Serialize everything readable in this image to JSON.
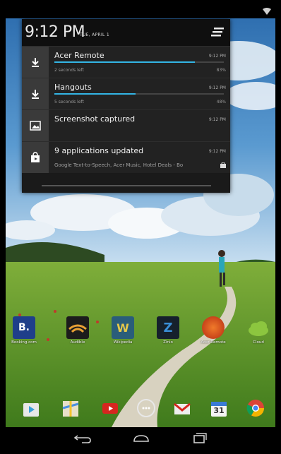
{
  "shade": {
    "time": "9:12 PM",
    "date": "TUE, APRIL 1",
    "notifications": [
      {
        "icon": "download-icon",
        "title": "Acer Remote",
        "time": "9:12 PM",
        "sub": "2 seconds left",
        "pct": "83%",
        "progress": 0.83
      },
      {
        "icon": "download-icon",
        "title": "Hangouts",
        "time": "9:12 PM",
        "sub": "5 seconds left",
        "pct": "48%",
        "progress": 0.48
      },
      {
        "icon": "image-icon",
        "title": "Screenshot captured",
        "time": "9:12 PM"
      },
      {
        "icon": "store-bag-icon",
        "title": "9 applications updated",
        "time": "9:12 PM",
        "desc": "Google Text-to-Speech, Acer Music, Hotel Deals - Bo"
      }
    ]
  },
  "apps": [
    {
      "label": "Booking.com",
      "icon_text": "B."
    },
    {
      "label": "Audible",
      "icon_text": ""
    },
    {
      "label": "Wikipedia",
      "icon_text": "W"
    },
    {
      "label": "Zinio",
      "icon_text": "Z"
    },
    {
      "label": "Acer Remote",
      "icon_text": ""
    },
    {
      "label": "Cloud",
      "icon_text": ""
    }
  ],
  "dock": {
    "calendar_day": "31"
  },
  "colors": {
    "accent": "#33b5e5",
    "shade_bg": "#1a1a1a",
    "icon_box": "#3a3a3a"
  }
}
